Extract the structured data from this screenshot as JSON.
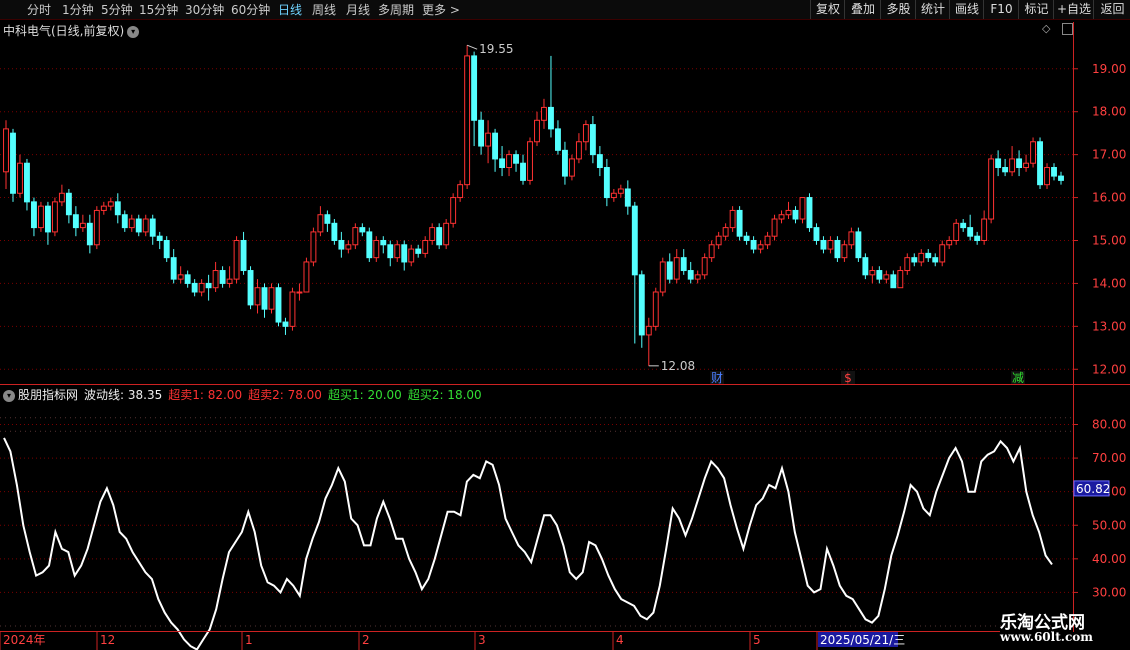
{
  "toolbar": {
    "periods": [
      "分时",
      "1分钟",
      "5分钟",
      "15分钟",
      "30分钟",
      "60分钟",
      "日线",
      "周线",
      "月线",
      "多周期",
      "更多 >"
    ],
    "active_period": "日线",
    "right_buttons": [
      "复权",
      "叠加",
      "多股",
      "统计",
      "画线",
      "F10",
      "标记",
      "+自选",
      "返回"
    ]
  },
  "stock": {
    "title": "中科电气(日线,前复权)"
  },
  "indicator": {
    "name": "股朋指标网",
    "wave_label": "波动线: 38.35",
    "sell1": "超卖1: 82.00",
    "sell2": "超卖2: 78.00",
    "buy1": "超买1: 20.00",
    "buy2": "超买2: 18.00"
  },
  "colors": {
    "up": "#ff3232",
    "down": "#54ffff",
    "line": "#ffffff",
    "grid": "#7a0000",
    "axis": "#cc2222",
    "price_text": "#ff4040",
    "highlight": "#1a1aa0"
  },
  "watermark": {
    "title": "乐淘公式网",
    "url": "www.60lt.com"
  },
  "chart_data": [
    {
      "type": "candlestick",
      "title": "中科电气(日线,前复权)",
      "yticks": [
        12.0,
        13.0,
        14.0,
        15.0,
        16.0,
        17.0,
        18.0,
        19.0
      ],
      "ylim": [
        11.75,
        19.95
      ],
      "annotations": {
        "high": "19.55",
        "low": "12.08"
      },
      "event_markers": [
        {
          "label": "财"
        },
        {
          "label": "$"
        },
        {
          "label": "减"
        }
      ],
      "candles": [
        [
          16.6,
          17.6,
          17.8,
          16.2
        ],
        [
          17.5,
          16.1,
          17.6,
          15.9
        ],
        [
          16.1,
          16.8,
          17.0,
          16.0
        ],
        [
          16.8,
          15.9,
          16.9,
          15.7
        ],
        [
          15.9,
          15.3,
          16.0,
          15.1
        ],
        [
          15.3,
          15.8,
          15.9,
          15.2
        ],
        [
          15.8,
          15.2,
          15.9,
          14.9
        ],
        [
          15.2,
          15.9,
          16.0,
          15.1
        ],
        [
          15.9,
          16.1,
          16.3,
          15.8
        ],
        [
          16.1,
          15.6,
          16.2,
          15.4
        ],
        [
          15.6,
          15.3,
          15.8,
          15.1
        ],
        [
          15.3,
          15.4,
          15.6,
          15.2
        ],
        [
          15.4,
          14.9,
          15.6,
          14.7
        ],
        [
          14.9,
          15.7,
          15.8,
          14.8
        ],
        [
          15.7,
          15.8,
          15.9,
          15.6
        ],
        [
          15.8,
          15.9,
          16.0,
          15.7
        ],
        [
          15.9,
          15.6,
          16.1,
          15.4
        ],
        [
          15.6,
          15.3,
          15.7,
          15.2
        ],
        [
          15.3,
          15.5,
          15.6,
          15.2
        ],
        [
          15.5,
          15.2,
          15.6,
          15.1
        ],
        [
          15.2,
          15.5,
          15.6,
          15.1
        ],
        [
          15.5,
          15.1,
          15.6,
          14.9
        ],
        [
          15.1,
          15.0,
          15.2,
          14.8
        ],
        [
          15.0,
          14.6,
          15.1,
          14.5
        ],
        [
          14.6,
          14.1,
          14.8,
          14.0
        ],
        [
          14.1,
          14.2,
          14.4,
          14.0
        ],
        [
          14.2,
          14.0,
          14.3,
          13.9
        ],
        [
          14.0,
          13.8,
          14.1,
          13.7
        ],
        [
          13.8,
          14.0,
          14.1,
          13.7
        ],
        [
          14.0,
          13.9,
          14.2,
          13.6
        ],
        [
          13.9,
          14.3,
          14.5,
          13.8
        ],
        [
          14.3,
          14.0,
          14.4,
          13.9
        ],
        [
          14.0,
          14.1,
          14.4,
          13.9
        ],
        [
          14.1,
          15.0,
          15.1,
          14.0
        ],
        [
          15.0,
          14.3,
          15.2,
          14.2
        ],
        [
          14.3,
          13.5,
          14.4,
          13.4
        ],
        [
          13.5,
          13.9,
          14.1,
          13.3
        ],
        [
          13.9,
          13.4,
          14.0,
          13.2
        ],
        [
          13.4,
          13.9,
          14.0,
          13.3
        ],
        [
          13.9,
          13.1,
          14.0,
          13.0
        ],
        [
          13.1,
          13.0,
          13.2,
          12.8
        ],
        [
          13.0,
          13.8,
          13.9,
          12.9
        ],
        [
          13.8,
          13.8,
          14.0,
          13.6
        ],
        [
          13.8,
          14.5,
          14.6,
          13.8
        ],
        [
          14.5,
          15.2,
          15.3,
          14.4
        ],
        [
          15.2,
          15.6,
          15.8,
          15.1
        ],
        [
          15.6,
          15.4,
          15.7,
          15.2
        ],
        [
          15.4,
          15.0,
          15.5,
          14.9
        ],
        [
          15.0,
          14.8,
          15.2,
          14.6
        ],
        [
          14.8,
          14.9,
          15.0,
          14.7
        ],
        [
          14.9,
          15.3,
          15.4,
          14.8
        ],
        [
          15.3,
          15.2,
          15.4,
          15.1
        ],
        [
          15.2,
          14.6,
          15.3,
          14.5
        ],
        [
          14.6,
          15.0,
          15.1,
          14.5
        ],
        [
          15.0,
          14.9,
          15.1,
          14.7
        ],
        [
          14.9,
          14.6,
          15.0,
          14.4
        ],
        [
          14.6,
          14.9,
          15.0,
          14.5
        ],
        [
          14.9,
          14.5,
          15.0,
          14.3
        ],
        [
          14.5,
          14.8,
          14.9,
          14.4
        ],
        [
          14.8,
          14.7,
          14.9,
          14.6
        ],
        [
          14.7,
          15.0,
          15.1,
          14.6
        ],
        [
          15.0,
          15.3,
          15.4,
          14.9
        ],
        [
          15.3,
          14.9,
          15.4,
          14.8
        ],
        [
          14.9,
          15.4,
          15.5,
          14.8
        ],
        [
          15.4,
          16.0,
          16.1,
          15.3
        ],
        [
          16.0,
          16.3,
          16.4,
          15.9
        ],
        [
          16.3,
          19.3,
          19.55,
          16.2
        ],
        [
          19.3,
          17.8,
          19.4,
          17.2
        ],
        [
          17.8,
          17.2,
          18.0,
          17.0
        ],
        [
          17.2,
          17.5,
          17.8,
          16.8
        ],
        [
          17.5,
          16.9,
          17.6,
          16.6
        ],
        [
          16.9,
          16.7,
          17.2,
          16.5
        ],
        [
          16.7,
          17.0,
          17.1,
          16.5
        ],
        [
          17.0,
          16.8,
          17.1,
          16.6
        ],
        [
          16.8,
          16.4,
          17.0,
          16.3
        ],
        [
          16.4,
          17.3,
          17.4,
          16.3
        ],
        [
          17.3,
          17.8,
          18.0,
          17.2
        ],
        [
          17.8,
          18.1,
          18.3,
          17.6
        ],
        [
          18.1,
          17.6,
          19.3,
          17.4
        ],
        [
          17.6,
          17.1,
          17.8,
          17.0
        ],
        [
          17.1,
          16.5,
          17.3,
          16.3
        ],
        [
          16.5,
          16.9,
          17.0,
          16.4
        ],
        [
          16.9,
          17.3,
          17.5,
          16.8
        ],
        [
          17.3,
          17.7,
          17.8,
          17.1
        ],
        [
          17.7,
          17.0,
          17.9,
          16.8
        ],
        [
          17.0,
          16.7,
          17.2,
          16.5
        ],
        [
          16.7,
          16.0,
          16.9,
          15.8
        ],
        [
          16.0,
          16.1,
          16.2,
          15.9
        ],
        [
          16.1,
          16.2,
          16.3,
          16.0
        ],
        [
          16.2,
          15.8,
          16.4,
          15.6
        ],
        [
          15.8,
          14.2,
          15.9,
          12.6
        ],
        [
          14.2,
          12.8,
          14.3,
          12.5
        ],
        [
          12.8,
          13.0,
          13.2,
          12.08
        ],
        [
          13.0,
          13.8,
          13.9,
          12.9
        ],
        [
          13.8,
          14.5,
          14.6,
          13.7
        ],
        [
          14.5,
          14.1,
          14.7,
          14.0
        ],
        [
          14.1,
          14.6,
          14.8,
          14.0
        ],
        [
          14.6,
          14.3,
          14.8,
          14.2
        ],
        [
          14.3,
          14.1,
          14.5,
          14.0
        ],
        [
          14.1,
          14.2,
          14.3,
          14.0
        ],
        [
          14.2,
          14.6,
          14.7,
          14.1
        ],
        [
          14.6,
          14.9,
          15.0,
          14.5
        ],
        [
          14.9,
          15.1,
          15.2,
          14.8
        ],
        [
          15.1,
          15.3,
          15.4,
          15.0
        ],
        [
          15.3,
          15.7,
          15.8,
          15.2
        ],
        [
          15.7,
          15.1,
          15.8,
          15.0
        ],
        [
          15.1,
          15.0,
          15.2,
          14.9
        ],
        [
          15.0,
          14.8,
          15.1,
          14.7
        ],
        [
          14.8,
          14.9,
          15.0,
          14.7
        ],
        [
          14.9,
          15.1,
          15.2,
          14.8
        ],
        [
          15.1,
          15.5,
          15.6,
          15.0
        ],
        [
          15.5,
          15.6,
          15.7,
          15.4
        ],
        [
          15.6,
          15.7,
          15.9,
          15.5
        ],
        [
          15.7,
          15.5,
          15.8,
          15.4
        ],
        [
          15.5,
          16.0,
          16.0,
          15.4
        ],
        [
          16.0,
          15.3,
          16.1,
          15.2
        ],
        [
          15.3,
          15.0,
          15.4,
          14.9
        ],
        [
          15.0,
          14.8,
          15.1,
          14.7
        ],
        [
          14.8,
          15.0,
          15.1,
          14.7
        ],
        [
          15.0,
          14.6,
          15.1,
          14.5
        ],
        [
          14.6,
          14.9,
          15.0,
          14.5
        ],
        [
          14.9,
          15.2,
          15.3,
          14.8
        ],
        [
          15.2,
          14.6,
          15.3,
          14.5
        ],
        [
          14.6,
          14.2,
          14.7,
          14.1
        ],
        [
          14.2,
          14.3,
          14.4,
          14.0
        ],
        [
          14.3,
          14.1,
          14.4,
          14.0
        ],
        [
          14.1,
          14.2,
          14.3,
          14.0
        ],
        [
          14.2,
          13.9,
          14.3,
          13.9
        ],
        [
          13.9,
          14.3,
          14.4,
          13.9
        ],
        [
          14.3,
          14.6,
          14.7,
          14.2
        ],
        [
          14.6,
          14.5,
          14.7,
          14.4
        ],
        [
          14.5,
          14.7,
          14.8,
          14.4
        ],
        [
          14.7,
          14.6,
          14.8,
          14.5
        ],
        [
          14.6,
          14.5,
          14.7,
          14.4
        ],
        [
          14.5,
          14.9,
          15.0,
          14.4
        ],
        [
          14.9,
          15.0,
          15.1,
          14.8
        ],
        [
          15.0,
          15.4,
          15.5,
          14.9
        ],
        [
          15.4,
          15.3,
          15.5,
          15.2
        ],
        [
          15.3,
          15.1,
          15.6,
          15.0
        ],
        [
          15.1,
          15.0,
          15.2,
          14.9
        ],
        [
          15.0,
          15.5,
          15.7,
          14.9
        ],
        [
          15.5,
          16.9,
          17.0,
          15.4
        ],
        [
          16.9,
          16.7,
          17.1,
          16.5
        ],
        [
          16.7,
          16.6,
          16.9,
          16.5
        ],
        [
          16.6,
          16.9,
          17.2,
          16.5
        ],
        [
          16.9,
          16.7,
          17.1,
          16.5
        ],
        [
          16.7,
          16.8,
          17.0,
          16.6
        ],
        [
          16.8,
          17.3,
          17.4,
          16.7
        ],
        [
          17.3,
          16.3,
          17.4,
          16.2
        ],
        [
          16.3,
          16.7,
          16.8,
          16.2
        ],
        [
          16.7,
          16.5,
          16.8,
          16.4
        ],
        [
          16.5,
          16.4,
          16.6,
          16.3
        ]
      ]
    },
    {
      "type": "line",
      "title": "股朋指标网",
      "series": [
        {
          "name": "波动线",
          "values": [
            76,
            72,
            62,
            50,
            42,
            35,
            36,
            38,
            48,
            43,
            42,
            35,
            38,
            43,
            50,
            57,
            61,
            56,
            48,
            46,
            42,
            39,
            36,
            34,
            28,
            24,
            21,
            19,
            16,
            14,
            13,
            16,
            19,
            25,
            34,
            42,
            45,
            48,
            54,
            48,
            38,
            33,
            32,
            30,
            34,
            32,
            29,
            40,
            46,
            51,
            58,
            62,
            67,
            63,
            52,
            50,
            44,
            44,
            52,
            57,
            52,
            46,
            46,
            40,
            36,
            31,
            34,
            40,
            47,
            54,
            54,
            53,
            63,
            65,
            64,
            69,
            68,
            62,
            52,
            48,
            44,
            42,
            39,
            46,
            53,
            53,
            50,
            44,
            36,
            34,
            36,
            45,
            44,
            40,
            35,
            31,
            28,
            27,
            26,
            23,
            22,
            24,
            32,
            43,
            55,
            52,
            47,
            52,
            58,
            64,
            69,
            67,
            64,
            56,
            49,
            43,
            50,
            56,
            58,
            62,
            61,
            67,
            60,
            48,
            40,
            32,
            30,
            31,
            43,
            38,
            32,
            29,
            28,
            25,
            22,
            21,
            23,
            31,
            41,
            47,
            54,
            62,
            60,
            55,
            53,
            60,
            65,
            70,
            73,
            69,
            60,
            60,
            69,
            71,
            72,
            75,
            73,
            69,
            73,
            60,
            53,
            48,
            41,
            38.35
          ]
        }
      ],
      "yticks": [
        30,
        40,
        50,
        60,
        70,
        80
      ],
      "ylim": [
        20,
        87
      ],
      "current_label": "60.82",
      "thresholds": {
        "超卖1": 82,
        "超卖2": 78,
        "超买1": 20,
        "超买2": 18
      },
      "x_labels": [
        "2024年",
        "12",
        "1",
        "2",
        "3",
        "4",
        "5",
        "2025/05/21/三"
      ]
    }
  ]
}
